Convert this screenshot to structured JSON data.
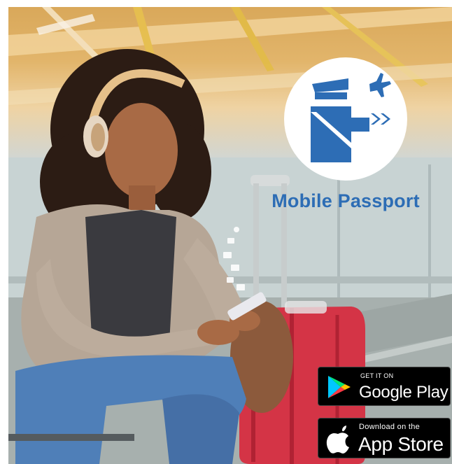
{
  "brand": {
    "title": "Mobile Passport",
    "logo_icon": "customs-officer-plane-icon",
    "accent_color": "#2d6db5"
  },
  "badges": {
    "google": {
      "small": "GET IT ON",
      "big": "Google Play",
      "icon": "google-play-icon"
    },
    "apple": {
      "small": "Download on the",
      "big": "App Store",
      "icon": "apple-icon"
    }
  }
}
